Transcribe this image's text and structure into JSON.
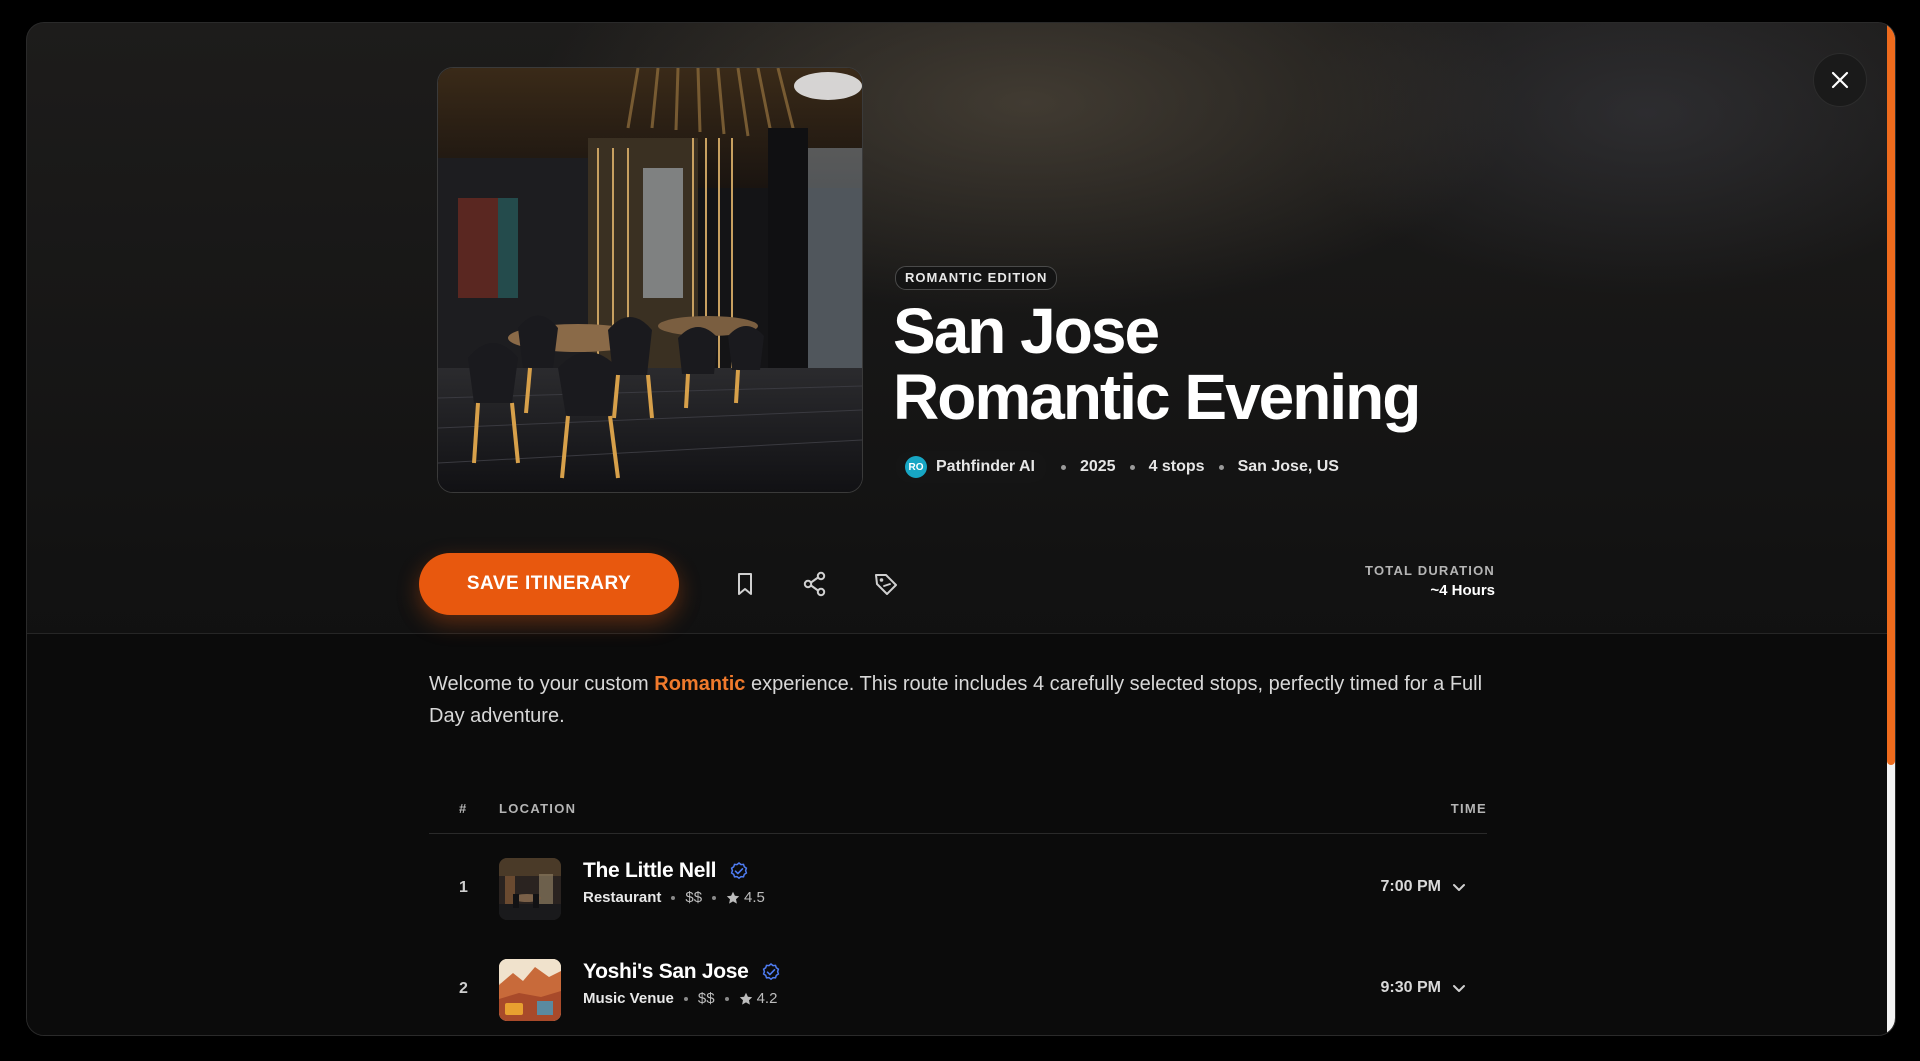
{
  "header": {
    "badge": "ROMANTIC EDITION",
    "title_line1": "San Jose",
    "title_line2": "Romantic Evening",
    "author_initials": "RO",
    "author": "Pathfinder AI",
    "year": "2025",
    "stops": "4 stops",
    "location": "San Jose, US"
  },
  "actions": {
    "save_label": "SAVE ITINERARY"
  },
  "duration": {
    "label": "TOTAL DURATION",
    "value": "~4 Hours"
  },
  "intro": {
    "before": "Welcome to your custom ",
    "highlight": "Romantic",
    "after": " experience. This route includes 4 carefully selected stops, perfectly timed for a Full Day adventure."
  },
  "table": {
    "col_num": "#",
    "col_location": "LOCATION",
    "col_time": "TIME",
    "rows": [
      {
        "num": "1",
        "name": "The Little Nell",
        "category": "Restaurant",
        "price": "$$",
        "rating": "4.5",
        "time": "7:00 PM"
      },
      {
        "num": "2",
        "name": "Yoshi's San Jose",
        "category": "Music Venue",
        "price": "$$",
        "rating": "4.2",
        "time": "9:30 PM"
      }
    ]
  },
  "colors": {
    "accent": "#e8580e",
    "verified": "#4f7df3",
    "avatar": "#17a6c4"
  },
  "icons": [
    "close-icon",
    "bookmark-icon",
    "share-icon",
    "tag-icon",
    "verified-icon",
    "star-icon",
    "chevron-down-icon"
  ]
}
